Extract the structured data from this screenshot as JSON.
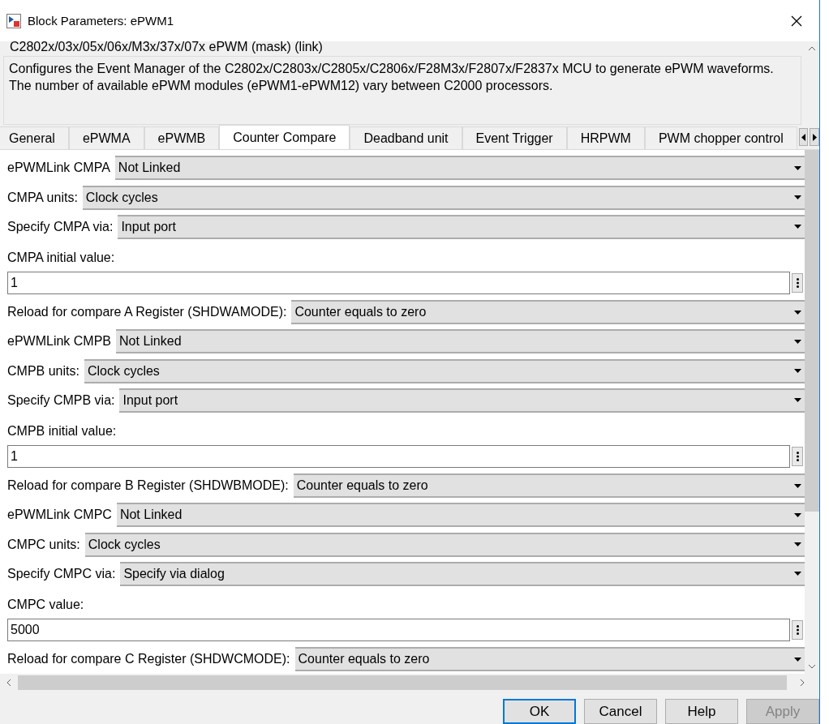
{
  "window": {
    "title": "Block Parameters: ePWM1"
  },
  "header": {
    "title": "C2802x/03x/05x/06x/M3x/37x/07x ePWM (mask) (link)",
    "description": [
      "Configures the Event Manager of the C2802x/C2803x/C2805x/C2806x/F28M3x/F2807x/F2837x MCU to generate ePWM waveforms.",
      "The number of available ePWM modules (ePWM1-ePWM12) vary between C2000 processors."
    ]
  },
  "tabs": [
    {
      "label": "General",
      "selected": false
    },
    {
      "label": "ePWMA",
      "selected": false
    },
    {
      "label": "ePWMB",
      "selected": false
    },
    {
      "label": "Counter Compare",
      "selected": true
    },
    {
      "label": "Deadband unit",
      "selected": false
    },
    {
      "label": "Event Trigger",
      "selected": false
    },
    {
      "label": "HRPWM",
      "selected": false
    },
    {
      "label": "PWM chopper control",
      "selected": false
    }
  ],
  "parameters": [
    {
      "kind": "dropdown",
      "label": "ePWMLink CMPA",
      "value": "Not Linked"
    },
    {
      "kind": "dropdown",
      "label": "CMPA units:",
      "value": "Clock cycles"
    },
    {
      "kind": "dropdown",
      "label": "Specify CMPA via:",
      "value": "Input port"
    },
    {
      "kind": "label",
      "label": "CMPA initial value:"
    },
    {
      "kind": "field",
      "value": "1"
    },
    {
      "kind": "dropdown",
      "label": "Reload for compare A Register (SHDWAMODE):",
      "value": "Counter equals to zero"
    },
    {
      "kind": "dropdown",
      "label": "ePWMLink CMPB",
      "value": "Not Linked"
    },
    {
      "kind": "dropdown",
      "label": "CMPB units:",
      "value": "Clock cycles"
    },
    {
      "kind": "dropdown",
      "label": "Specify CMPB via:",
      "value": "Input port"
    },
    {
      "kind": "label",
      "label": "CMPB initial value:"
    },
    {
      "kind": "field",
      "value": "1"
    },
    {
      "kind": "dropdown",
      "label": "Reload for compare B Register (SHDWBMODE):",
      "value": "Counter equals to zero"
    },
    {
      "kind": "dropdown",
      "label": "ePWMLink CMPC",
      "value": "Not Linked"
    },
    {
      "kind": "dropdown",
      "label": "CMPC units:",
      "value": "Clock cycles"
    },
    {
      "kind": "dropdown",
      "label": "Specify CMPC via:",
      "value": "Specify via dialog"
    },
    {
      "kind": "label",
      "label": "CMPC value:"
    },
    {
      "kind": "field",
      "value": "5000"
    },
    {
      "kind": "dropdown",
      "label": "Reload for compare C Register (SHDWCMODE):",
      "value": "Counter equals to zero"
    }
  ],
  "buttons": [
    {
      "label": "OK",
      "disabled": false,
      "default": true
    },
    {
      "label": "Cancel",
      "disabled": false,
      "default": false
    },
    {
      "label": "Help",
      "disabled": false,
      "default": false
    },
    {
      "label": "Apply",
      "disabled": true,
      "default": false
    }
  ]
}
